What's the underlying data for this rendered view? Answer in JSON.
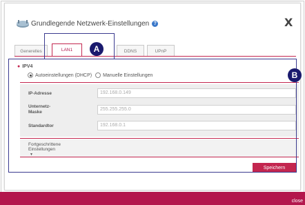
{
  "dialog": {
    "title": "Grundlegende Netzwerk-Einstellungen",
    "help_icon": "?",
    "close_label": "X"
  },
  "tabs": [
    {
      "label": "Generelles",
      "active": false
    },
    {
      "label": "LAN1",
      "active": true
    },
    {
      "label": "DDNS",
      "active": false
    },
    {
      "label": "UPnP",
      "active": false
    }
  ],
  "callouts": {
    "a": "A",
    "b": "B"
  },
  "ipv4": {
    "heading": "IPV4",
    "options": [
      {
        "label": "Autoeinstellungen (DHCP)",
        "selected": true
      },
      {
        "label": "Manuelle Einstellungen",
        "selected": false
      }
    ]
  },
  "fields": [
    {
      "label": "IP-Adresse",
      "value": "192.168.0.149"
    },
    {
      "label": "Unternetz-\nMaske",
      "value": "255.255.255.0"
    },
    {
      "label": "Standardtor",
      "value": "192.168.0.1"
    }
  ],
  "advanced": {
    "label": "Fortgeschrittene\nEinstellungen",
    "arrow": "▼"
  },
  "save_button": "Speichern",
  "outer_close": "close",
  "colors": {
    "accent": "#c3264f",
    "callout": "#1a1a6e",
    "bottom_bar": "#b3174d"
  }
}
